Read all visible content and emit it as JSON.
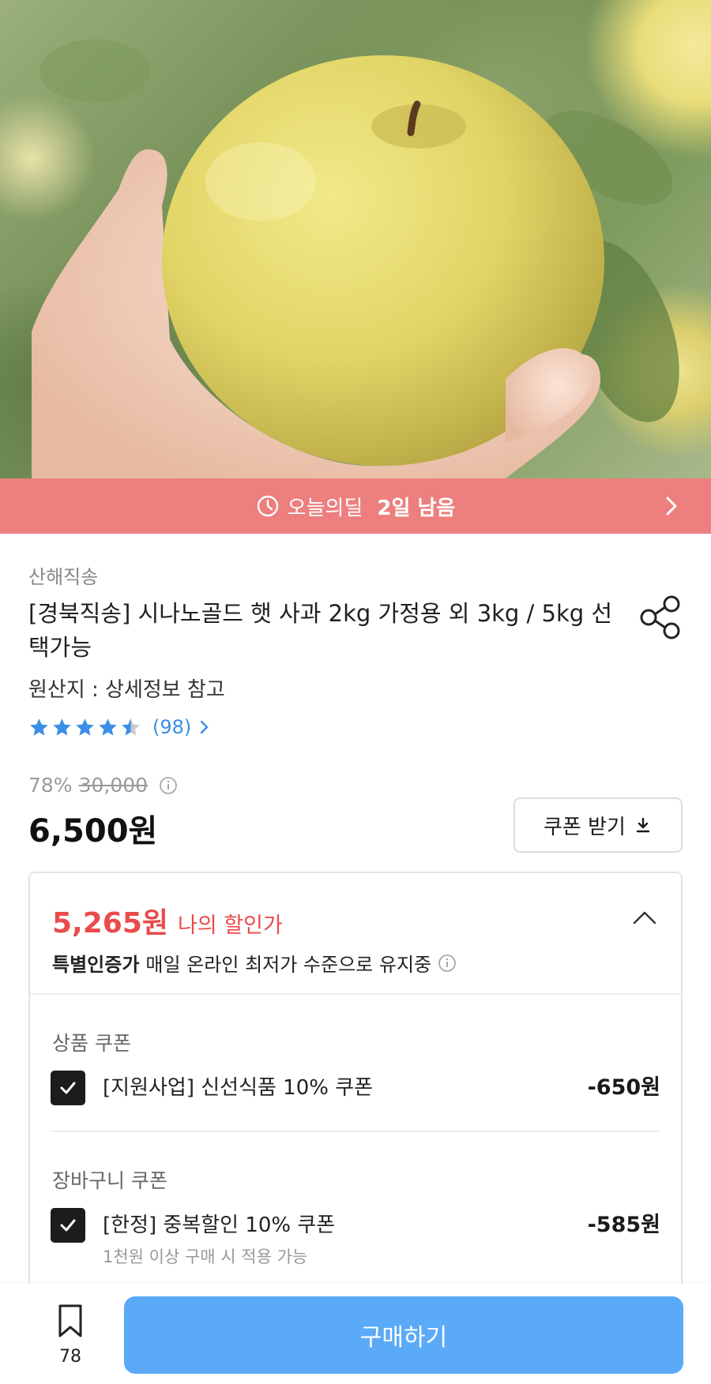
{
  "deal_banner": {
    "label": "오늘의딜",
    "remaining": "2일 남음"
  },
  "product": {
    "seller": "산해직송",
    "title": "[경북직송] 시나노골드 햇 사과 2kg 가정용 외 3kg / 5kg 선택가능",
    "origin": "원산지 : 상세정보 참고",
    "rating": {
      "value": 4.5,
      "max": 5,
      "count": "(98)"
    },
    "discount_rate": "78%",
    "original_price": "30,000",
    "sale_price": "6,500원"
  },
  "coupon_button": {
    "label": "쿠폰 받기"
  },
  "my_discount": {
    "price": "5,265원",
    "label": "나의 할인가",
    "special_bold": "특별인증가",
    "special_text": "매일 온라인 최저가 수준으로 유지중"
  },
  "coupon_groups": [
    {
      "label": "상품 쿠폰",
      "items": [
        {
          "name": "[지원사업] 신선식품 10% 쿠폰",
          "condition": "",
          "discount": "-650원",
          "checked": true
        }
      ]
    },
    {
      "label": "장바구니 쿠폰",
      "items": [
        {
          "name": "[한정] 중복할인 10% 쿠폰",
          "condition": "1천원 이상 구매 시 적용 가능",
          "discount": "-585원",
          "checked": true
        }
      ]
    }
  ],
  "bottom_bar": {
    "bookmark_count": "78",
    "buy_label": "구매하기"
  },
  "colors": {
    "deal_banner": "#ed7f7f",
    "star": "#3a8ee6",
    "my_price": "#ea4b4b",
    "buy_button": "#5aaaf7"
  }
}
